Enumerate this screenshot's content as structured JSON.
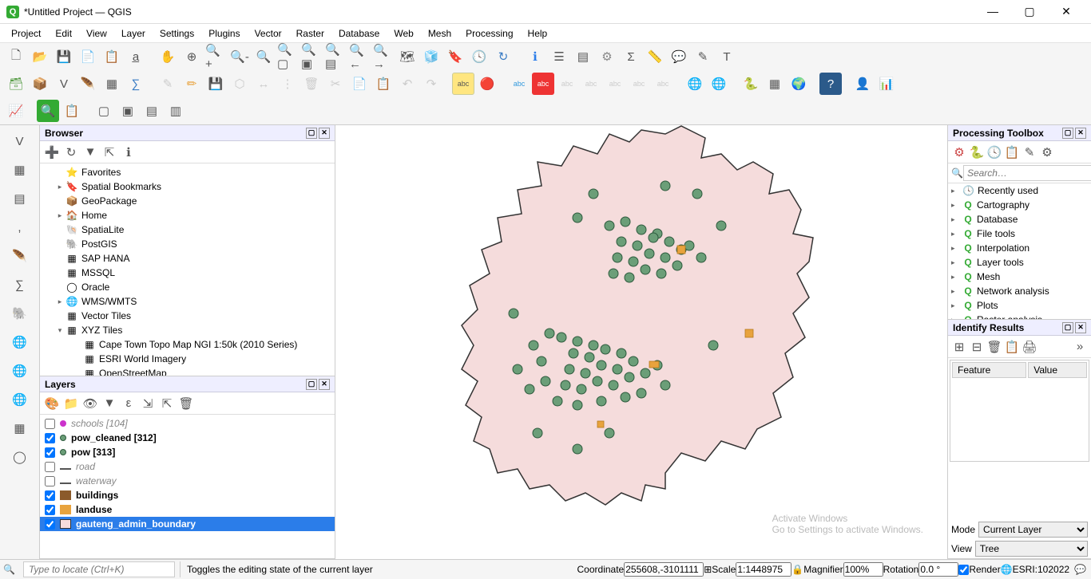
{
  "window": {
    "title": "*Untitled Project — QGIS"
  },
  "menu": [
    "Project",
    "Edit",
    "View",
    "Layer",
    "Settings",
    "Plugins",
    "Vector",
    "Raster",
    "Database",
    "Web",
    "Mesh",
    "Processing",
    "Help"
  ],
  "browser": {
    "title": "Browser",
    "items": [
      {
        "exp": "",
        "icon": "⭐",
        "label": "Favorites",
        "indent": 1
      },
      {
        "exp": "▸",
        "icon": "🔖",
        "label": "Spatial Bookmarks",
        "indent": 1
      },
      {
        "exp": "",
        "icon": "📦",
        "label": "GeoPackage",
        "indent": 1
      },
      {
        "exp": "▸",
        "icon": "🏠",
        "label": "Home",
        "indent": 1
      },
      {
        "exp": "",
        "icon": "🐚",
        "label": "SpatiaLite",
        "indent": 1
      },
      {
        "exp": "",
        "icon": "🐘",
        "label": "PostGIS",
        "indent": 1
      },
      {
        "exp": "",
        "icon": "▦",
        "label": "SAP HANA",
        "indent": 1
      },
      {
        "exp": "",
        "icon": "▦",
        "label": "MSSQL",
        "indent": 1
      },
      {
        "exp": "",
        "icon": "◯",
        "label": "Oracle",
        "indent": 1
      },
      {
        "exp": "▸",
        "icon": "🌐",
        "label": "WMS/WMTS",
        "indent": 1
      },
      {
        "exp": "",
        "icon": "▦",
        "label": "Vector Tiles",
        "indent": 1
      },
      {
        "exp": "▾",
        "icon": "▦",
        "label": "XYZ Tiles",
        "indent": 1
      },
      {
        "exp": "",
        "icon": "▦",
        "label": "Cape Town Topo Map NGI 1:50k (2010 Series)",
        "indent": 2
      },
      {
        "exp": "",
        "icon": "▦",
        "label": "ESRI World Imagery",
        "indent": 2
      },
      {
        "exp": "",
        "icon": "▦",
        "label": "OpenStreetMap",
        "indent": 2
      }
    ]
  },
  "layers": {
    "title": "Layers",
    "items": [
      {
        "checked": false,
        "sym": "dot-magenta",
        "label": "schools [104]",
        "italic": true,
        "bold": false,
        "selected": false
      },
      {
        "checked": true,
        "sym": "dot-green",
        "label": "pow_cleaned [312]",
        "italic": false,
        "bold": true,
        "selected": false
      },
      {
        "checked": true,
        "sym": "dot-green",
        "label": "pow [313]",
        "italic": false,
        "bold": true,
        "selected": false
      },
      {
        "checked": false,
        "sym": "line",
        "label": "road",
        "italic": true,
        "bold": false,
        "selected": false
      },
      {
        "checked": false,
        "sym": "line",
        "label": "waterway",
        "italic": true,
        "bold": false,
        "selected": false
      },
      {
        "checked": true,
        "sym": "sq-brown",
        "label": "buildings",
        "italic": false,
        "bold": true,
        "selected": false
      },
      {
        "checked": true,
        "sym": "sq-orange",
        "label": "landuse",
        "italic": false,
        "bold": true,
        "selected": false
      },
      {
        "checked": true,
        "sym": "sq-pink",
        "label": "gauteng_admin_boundary",
        "italic": false,
        "bold": true,
        "selected": true
      }
    ]
  },
  "toolbox": {
    "title": "Processing Toolbox",
    "search_placeholder": "Search…",
    "items": [
      {
        "icon": "🕓",
        "label": "Recently used"
      },
      {
        "icon": "Q",
        "label": "Cartography"
      },
      {
        "icon": "Q",
        "label": "Database"
      },
      {
        "icon": "Q",
        "label": "File tools"
      },
      {
        "icon": "Q",
        "label": "Interpolation"
      },
      {
        "icon": "Q",
        "label": "Layer tools"
      },
      {
        "icon": "Q",
        "label": "Mesh"
      },
      {
        "icon": "Q",
        "label": "Network analysis"
      },
      {
        "icon": "Q",
        "label": "Plots"
      },
      {
        "icon": "Q",
        "label": "Raster analysis"
      }
    ]
  },
  "identify": {
    "title": "Identify Results",
    "col_feature": "Feature",
    "col_value": "Value",
    "mode_label": "Mode",
    "mode_value": "Current Layer",
    "view_label": "View",
    "view_value": "Tree"
  },
  "status": {
    "hint": "Toggles the editing state of the current layer",
    "coord_label": "Coordinate",
    "coord_value": "255608,-3101111",
    "scale_label": "Scale",
    "scale_value": "1:1448975",
    "mag_label": "Magnifier",
    "mag_value": "100%",
    "rot_label": "Rotation",
    "rot_value": "0.0 °",
    "render_label": "Render",
    "crs_label": "ESRI:102022",
    "locate_placeholder": "Type to locate (Ctrl+K)"
  },
  "watermark": {
    "line1": "Activate Windows",
    "line2": "Go to Settings to activate Windows."
  }
}
